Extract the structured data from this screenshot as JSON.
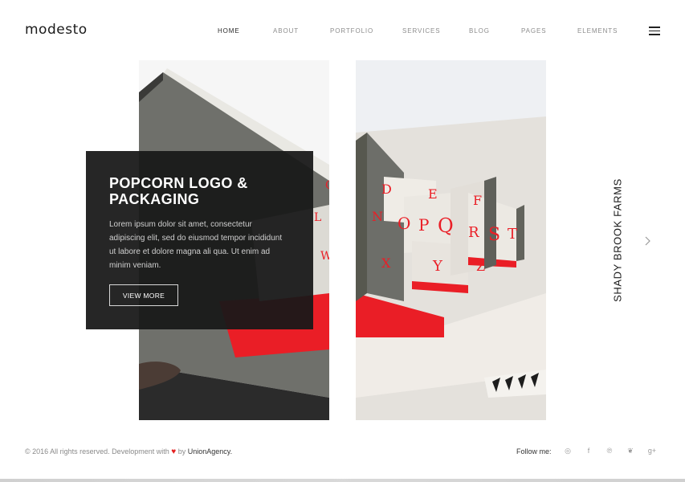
{
  "header": {
    "logo": "modesto",
    "nav": [
      {
        "label": "HOME",
        "active": true
      },
      {
        "label": "ABOUT",
        "active": false
      },
      {
        "label": "PORTFOLIO",
        "active": false
      },
      {
        "label": "SERVICES",
        "active": false
      },
      {
        "label": "BLOG",
        "active": false
      },
      {
        "label": "PAGES",
        "active": false
      },
      {
        "label": "ELEMENTS",
        "active": false
      }
    ],
    "menu_icon": "hamburger-icon"
  },
  "slide": {
    "title": "POPCORN LOGO & PACKAGING",
    "description": "Lorem ipsum dolor sit amet, consectetur adipiscing elit, sed do eiusmod tempor incididunt ut labore et dolore magna ali qua. Ut enim ad minim veniam.",
    "button_label": "VIEW MORE",
    "next_project": "SHADY BROOK FARMS",
    "next_icon": "chevron-right-icon",
    "book_letters": [
      "D",
      "E",
      "F",
      "N",
      "O",
      "P",
      "Q",
      "R",
      "S",
      "T",
      "X",
      "Y",
      "Z"
    ]
  },
  "footer": {
    "copyright_prefix": "© 2016 All rights reserved. Development with",
    "copyright_by": "by",
    "agency": "UnionAgency.",
    "follow_label": "Follow me:",
    "social": [
      {
        "icon": "instagram-icon",
        "glyph": "◎"
      },
      {
        "icon": "facebook-icon",
        "glyph": "f"
      },
      {
        "icon": "pinterest-icon",
        "glyph": "℗"
      },
      {
        "icon": "twitter-icon",
        "glyph": "❦"
      },
      {
        "icon": "google-plus-icon",
        "glyph": "g+"
      }
    ]
  },
  "colors": {
    "accent_red": "#ea1e26",
    "card_bg": "#181818",
    "book_grey": "#6d6e69"
  }
}
